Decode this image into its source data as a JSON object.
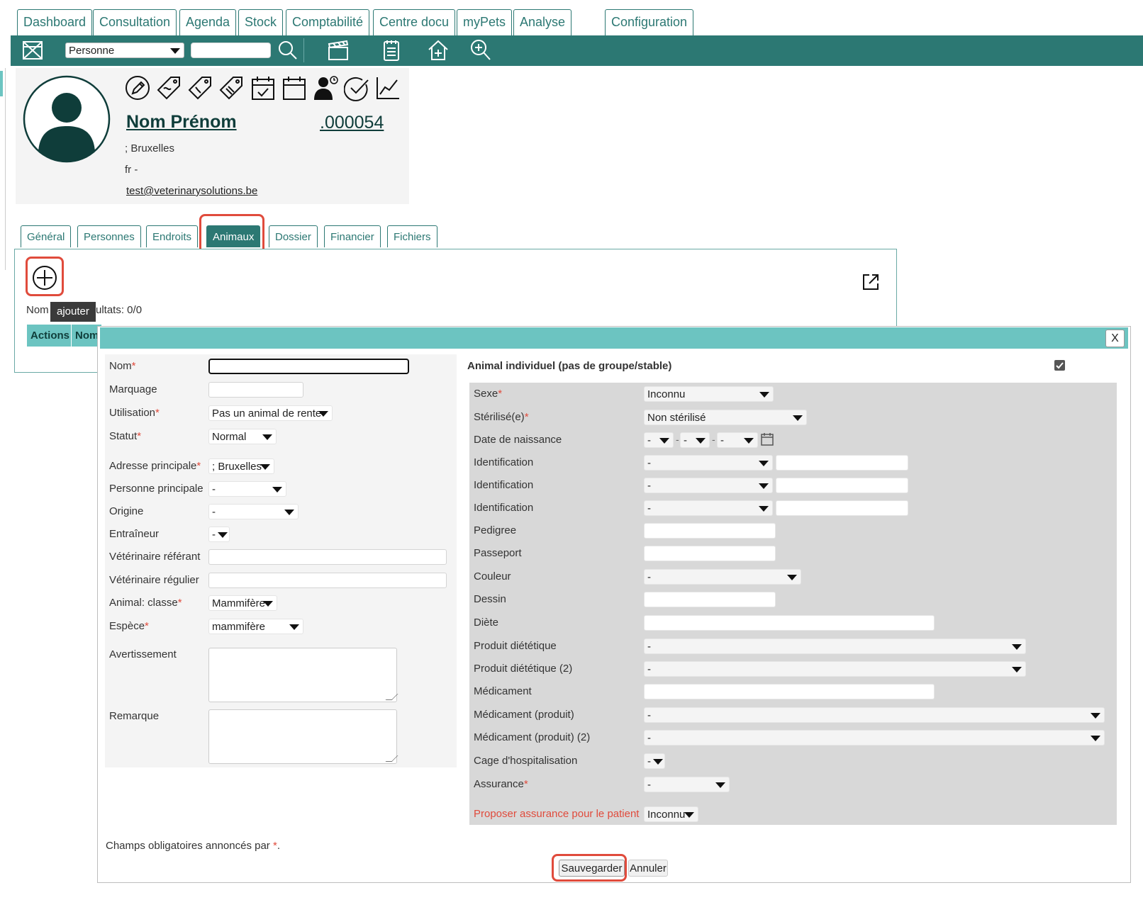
{
  "top_tabs": [
    "Dashboard",
    "Consultation",
    "Agenda",
    "Stock",
    "Comptabilité",
    "Centre docu",
    "myPets",
    "Analyse",
    "Configuration"
  ],
  "toolbar": {
    "search_type": "Personne",
    "search_value": ""
  },
  "profile": {
    "name": "Nom Prénom",
    "number": ".000054",
    "address": "; Bruxelles",
    "lang": "fr -",
    "email": "test@veterinarysolutions.be"
  },
  "sub_tabs": [
    "Général",
    "Personnes",
    "Endroits",
    "Animaux",
    "Dossier",
    "Financier",
    "Fichiers"
  ],
  "animals_panel": {
    "tooltip": "ajouter",
    "results_prefix": "Nom",
    "results_suffix": "ultats: 0/0",
    "col_actions": "Actions",
    "col_name": "Nom"
  },
  "dialog": {
    "close_label": "X",
    "left": {
      "nom_label": "Nom",
      "nom_value": "",
      "marquage_label": "Marquage",
      "utilisation_label": "Utilisation",
      "utilisation_value": "Pas un animal de rente",
      "statut_label": "Statut",
      "statut_value": "Normal",
      "adresse_label": "Adresse principale",
      "adresse_value": "; Bruxelles",
      "personne_label": "Personne principale",
      "personne_value": "-",
      "origine_label": "Origine",
      "origine_value": "-",
      "entraineur_label": "Entraîneur",
      "entraineur_value": "-",
      "vet_referant_label": "Vétérinaire référant",
      "vet_regulier_label": "Vétérinaire régulier",
      "classe_label": "Animal: classe",
      "classe_value": "Mammifère",
      "espece_label": "Espèce",
      "espece_value": "mammifère",
      "avertissement_label": "Avertissement",
      "remarque_label": "Remarque"
    },
    "right": {
      "header": "Animal individuel (pas de groupe/stable)",
      "individual_checked": true,
      "sexe_label": "Sexe",
      "sexe_value": "Inconnu",
      "sterilise_label": "Stérilisé(e)",
      "sterilise_value": "Non stérilisé",
      "naissance_label": "Date de naissance",
      "naissance_day": "-",
      "naissance_month": "-",
      "naissance_year": "-",
      "identification_label": "Identification",
      "identification_value": "-",
      "pedigree_label": "Pedigree",
      "passeport_label": "Passeport",
      "couleur_label": "Couleur",
      "couleur_value": "-",
      "dessin_label": "Dessin",
      "diete_label": "Diète",
      "produit_diet_label": "Produit diététique",
      "produit_diet_value": "-",
      "produit_diet2_label": "Produit diététique (2)",
      "produit_diet2_value": "-",
      "medicament_label": "Médicament",
      "med_produit_label": "Médicament (produit)",
      "med_produit_value": "-",
      "med_produit2_label": "Médicament (produit) (2)",
      "med_produit2_value": "-",
      "cage_label": "Cage d'hospitalisation",
      "cage_value": "-",
      "assurance_label": "Assurance",
      "assurance_value": "-",
      "proposer_label": "Proposer assurance pour le patient",
      "proposer_value": "Inconnu"
    },
    "required_note": "Champs obligatoires annoncés par",
    "required_star": "*",
    "required_end": ".",
    "save_label": "Sauvegarder",
    "cancel_label": "Annuler"
  },
  "colors": {
    "primary": "#2c7873",
    "dialog_header": "#6cc4c1",
    "highlight": "#e04b3c",
    "required": "#e04b3c"
  }
}
